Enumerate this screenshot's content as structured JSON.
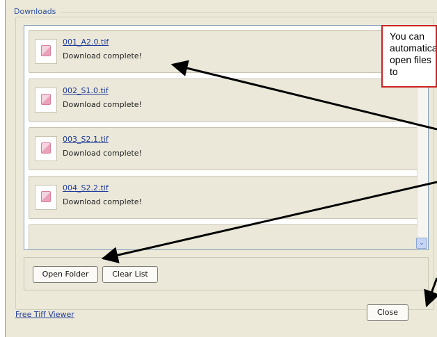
{
  "group": {
    "title": "Downloads"
  },
  "downloads": [
    {
      "name": "001_A2.0.tif",
      "status": "Download complete!"
    },
    {
      "name": "002_S1.0.tif",
      "status": "Download complete!"
    },
    {
      "name": "003_S2.1.tif",
      "status": "Download complete!"
    },
    {
      "name": "004_S2.2.tif",
      "status": "Download complete!"
    }
  ],
  "buttons": {
    "open_folder": "Open Folder",
    "clear_list": "Clear List",
    "close": "Close"
  },
  "footer": {
    "link": "Free Tiff Viewer"
  },
  "callout": {
    "text": "You can automatically open files to"
  },
  "colors": {
    "accent_link": "#1e3a9a",
    "callout_border": "#cc2222",
    "arrow": "#000000"
  },
  "icons": {
    "file": "image-file-icon",
    "scroll_down": "chevron-down-icon"
  }
}
